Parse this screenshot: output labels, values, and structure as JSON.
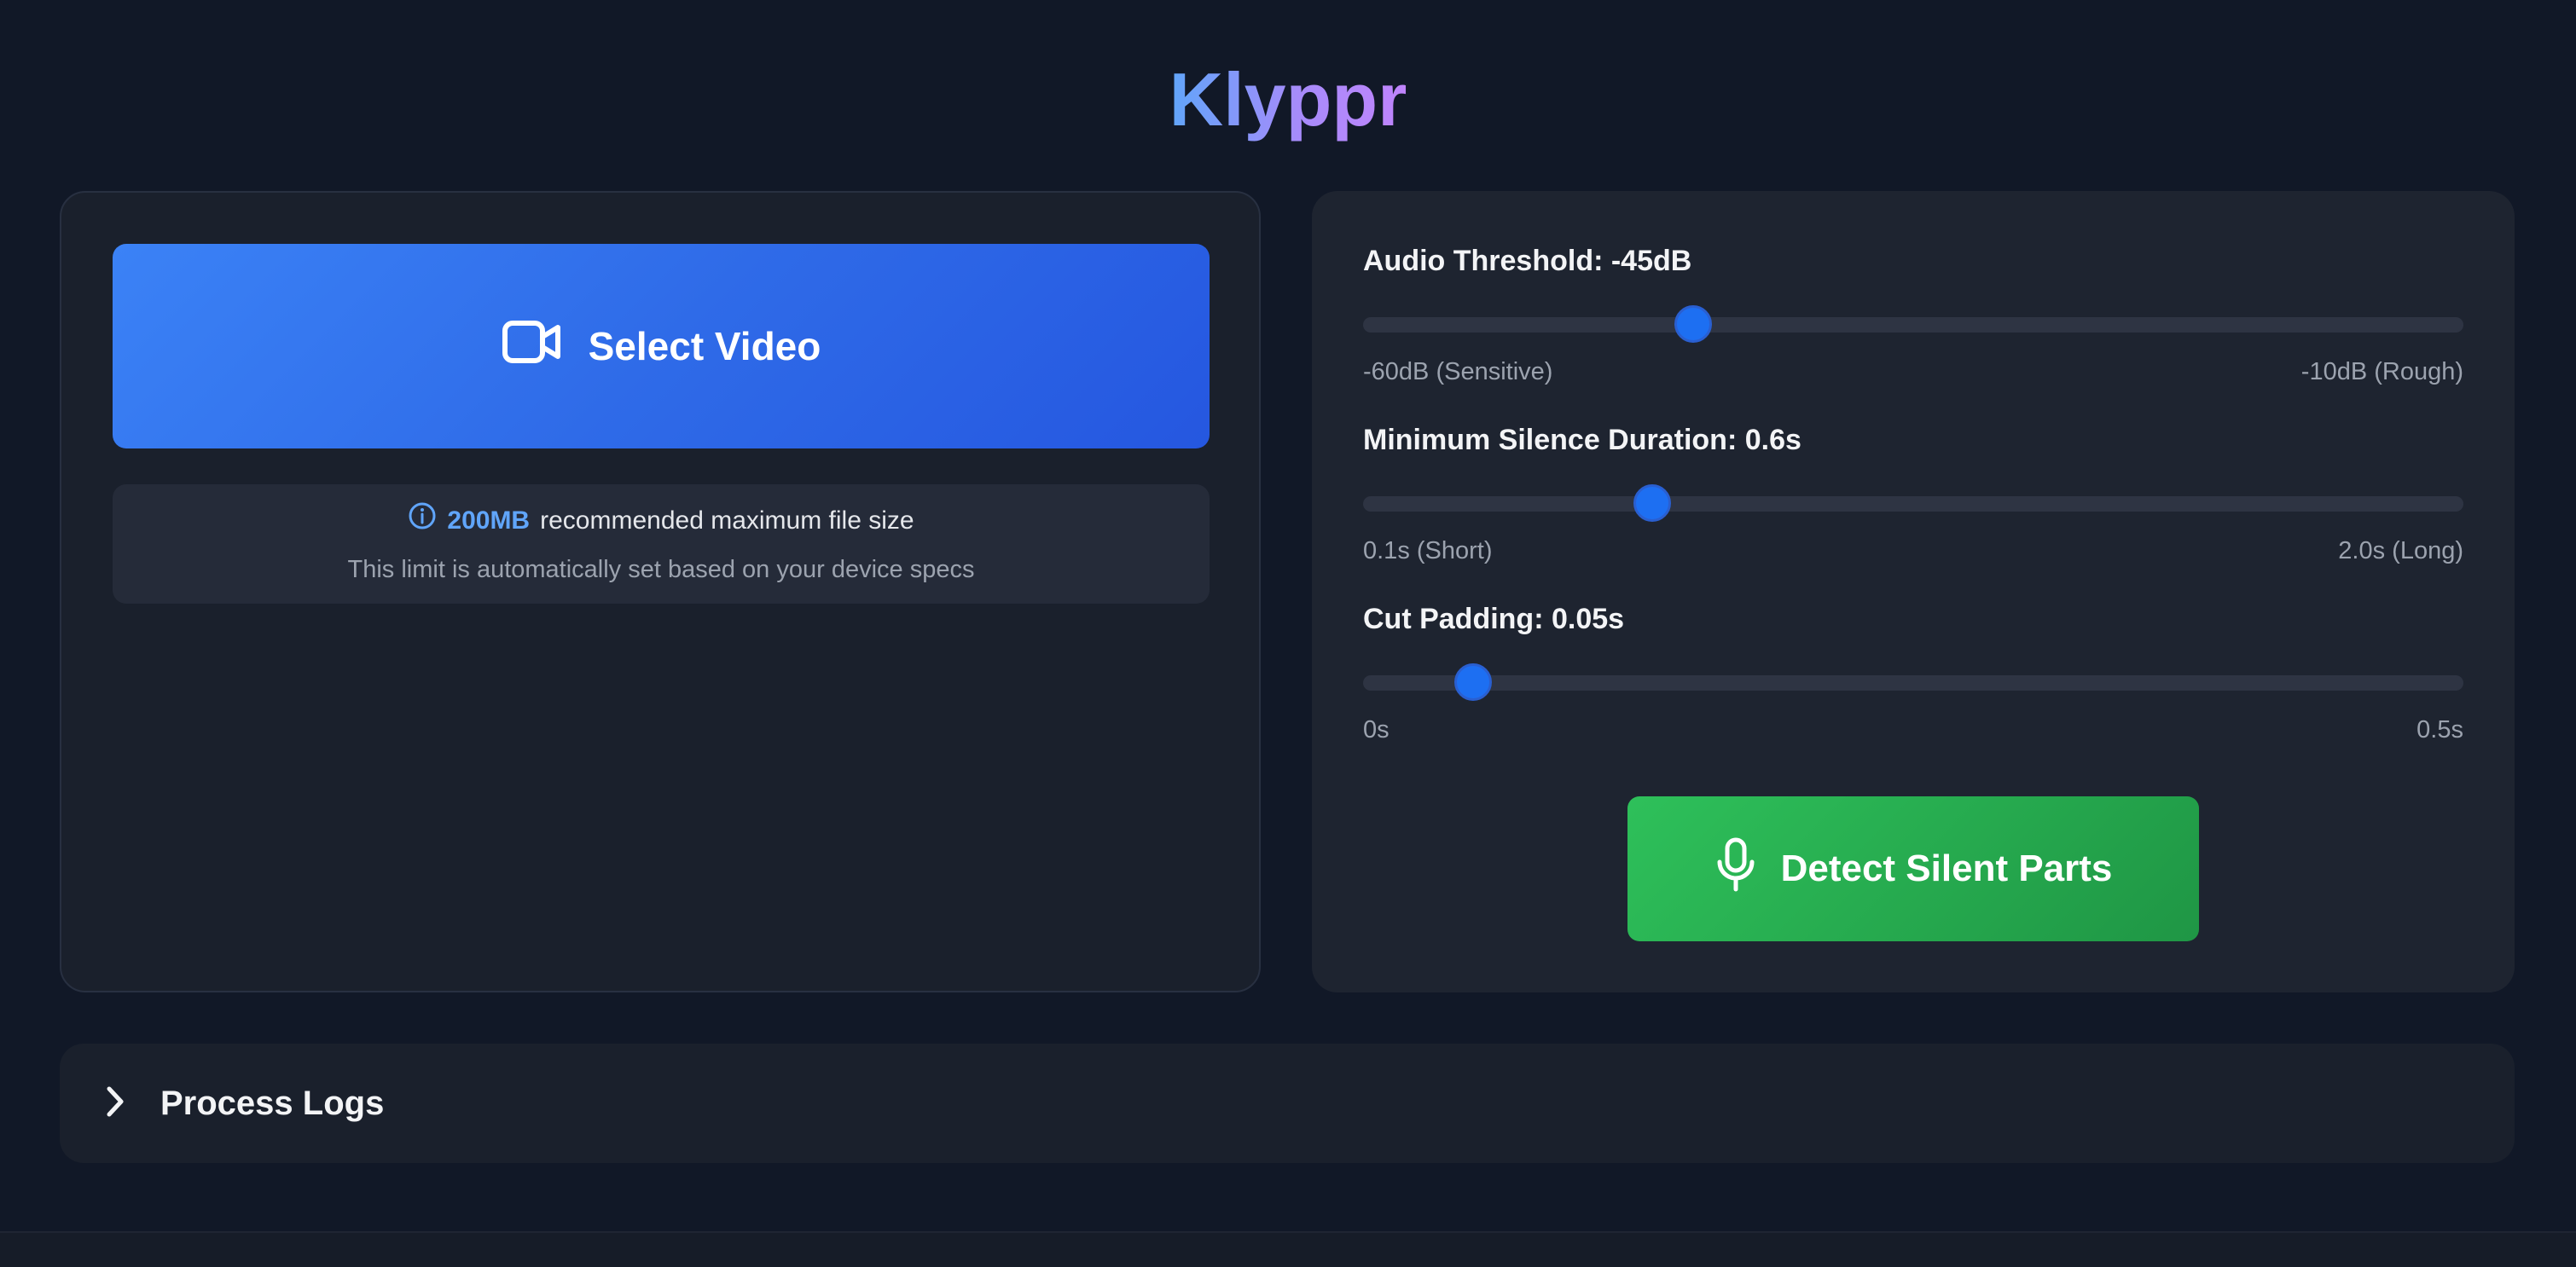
{
  "app": {
    "title": "Klyppr"
  },
  "upload": {
    "select_label": "Select Video",
    "size_value": "200MB",
    "size_text": "recommended maximum file size",
    "size_note": "This limit is automatically set based on your device specs"
  },
  "settings": {
    "threshold": {
      "label": "Audio Threshold: -45dB",
      "value": -45,
      "min": -60,
      "max": -10,
      "min_label": "-60dB (Sensitive)",
      "max_label": "-10dB (Rough)"
    },
    "silence": {
      "label": "Minimum Silence Duration: 0.6s",
      "value": 0.6,
      "min": 0.1,
      "max": 2.0,
      "min_label": "0.1s (Short)",
      "max_label": "2.0s (Long)"
    },
    "padding": {
      "label": "Cut Padding: 0.05s",
      "value": 0.05,
      "min": 0,
      "max": 0.5,
      "min_label": "0s",
      "max_label": "0.5s"
    },
    "detect_label": "Detect Silent Parts"
  },
  "logs": {
    "title": "Process Logs"
  },
  "colors": {
    "accent_blue": "#3b82f6",
    "accent_green": "#22a34b",
    "title_gradient_start": "#60a5fa",
    "title_gradient_end": "#c084fc"
  },
  "icons": {
    "select": "video-camera-icon",
    "info": "info-icon",
    "detect": "microphone-icon",
    "logs": "chevron-right-icon"
  }
}
